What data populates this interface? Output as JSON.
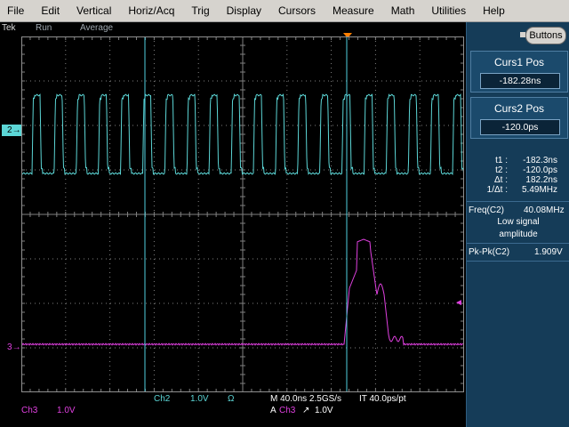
{
  "menu": [
    "File",
    "Edit",
    "Vertical",
    "Horiz/Acq",
    "Trig",
    "Display",
    "Cursors",
    "Measure",
    "Math",
    "Utilities",
    "Help"
  ],
  "status": {
    "brand": "Tek",
    "state": "Run",
    "mode": "Average"
  },
  "buttons_label": "Buttons",
  "cursor1": {
    "title": "Curs1 Pos",
    "value": "-182.28ns"
  },
  "cursor2": {
    "title": "Curs2 Pos",
    "value": "-120.0ps"
  },
  "readouts": [
    {
      "label": "t1 :",
      "value": "-182.3ns"
    },
    {
      "label": "t2 :",
      "value": "-120.0ps"
    },
    {
      "label": "Δt :",
      "value": "182.2ns"
    },
    {
      "label": "1/Δt :",
      "value": "5.49MHz"
    }
  ],
  "freq": {
    "label": "Freq(C2)",
    "value": "40.08MHz",
    "note1": "Low signal",
    "note2": "amplitude"
  },
  "pkpk": {
    "label": "Pk-Pk(C2)",
    "value": "1.909V"
  },
  "markers": {
    "ch2": "2",
    "ch3": "3"
  },
  "bottom": {
    "ch2_name": "Ch2",
    "ch2_scale": "1.0V",
    "ch2_coupling": "Ω",
    "timebase": "M 40.0ns 2.5GS/s",
    "interp": "IT 40.0ps/pt",
    "trig_prefix": "A",
    "trig_source": "Ch3",
    "trig_slope": "↗",
    "trig_level": "1.0V",
    "ch3_name": "Ch3",
    "ch3_scale": "1.0V"
  },
  "colors": {
    "ch2": "#5cd6d6",
    "ch3": "#e040e0",
    "cursor": "#4fd0e0",
    "grid": "#808080",
    "trigger": "#ff8000"
  }
}
